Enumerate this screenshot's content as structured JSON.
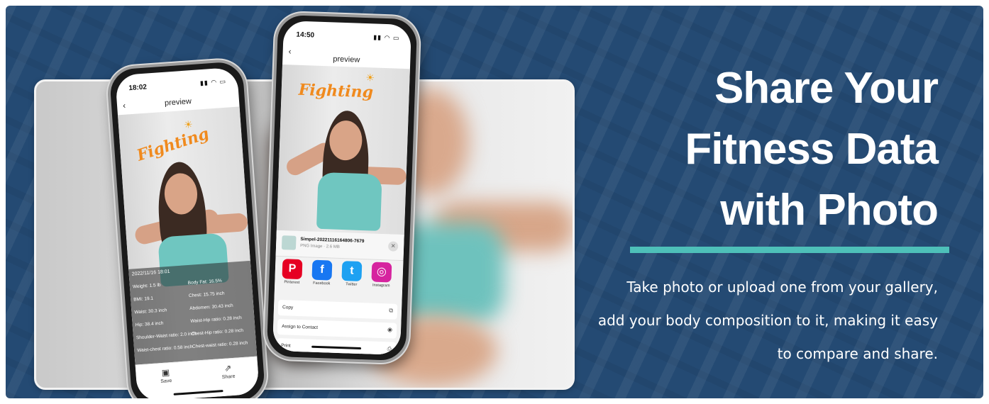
{
  "headline": {
    "line1": "Share Your",
    "line2": "Fitness Data",
    "line3": "with Photo"
  },
  "description": "Take photo or upload one from your gallery, add your body composition to it, making it easy to compare and share.",
  "colors": {
    "background": "#244a73",
    "accent": "#4ec0b9",
    "text": "#ffffff",
    "fighting": "#f08a1e"
  },
  "left_phone": {
    "time": "18:02",
    "title": "preview",
    "back_icon": "chevron-left-icon",
    "overlay_text": "Fighting",
    "date": "2022/11/16 18:01",
    "stats": [
      {
        "label": "Weight: 1.5 lb",
        "col": 0
      },
      {
        "label": "Body Fat: 16.5%",
        "col": 1
      },
      {
        "label": "BMI: 19.1",
        "col": 0
      },
      {
        "label": "Chest: 15.75 inch",
        "col": 1
      },
      {
        "label": "Waist: 30.3 inch",
        "col": 0
      },
      {
        "label": "Abdomen: 30.43 inch",
        "col": 1
      },
      {
        "label": "Hip: 38.4 inch",
        "col": 0
      },
      {
        "label": "Waist-Hip ratio: 0.28 inch",
        "col": 1
      },
      {
        "label": "Shoulder-Waist ratio: 2.0 inch",
        "col": 0
      },
      {
        "label": "Chest-Hip ratio: 0.28 inch",
        "col": 1
      },
      {
        "label": "Waist-chest ratio: 0.58 inch",
        "col": 0
      },
      {
        "label": "Chest-waist ratio: 0.28 inch",
        "col": 1
      }
    ],
    "save_label": "Save",
    "share_label": "Share"
  },
  "right_phone": {
    "time": "14:50",
    "title": "preview",
    "back_icon": "chevron-left-icon",
    "overlay_text": "Fighting",
    "file_name": "Simpel-20221116164806-7679",
    "file_meta": "PNG Image · 2.6 MB",
    "apps": [
      {
        "label": "Pinterest",
        "icon": "pinterest-icon",
        "color": "#e60023",
        "glyph": "P"
      },
      {
        "label": "Facebook",
        "icon": "facebook-icon",
        "color": "#1877f2",
        "glyph": "f"
      },
      {
        "label": "Twitter",
        "icon": "twitter-icon",
        "color": "#1da1f2",
        "glyph": "t"
      },
      {
        "label": "Instagram",
        "icon": "instagram-icon",
        "color": "#d6249f",
        "glyph": "◎"
      }
    ],
    "actions": [
      {
        "label": "Copy",
        "icon": "copy-icon"
      },
      {
        "label": "Assign to Contact",
        "icon": "contact-icon"
      },
      {
        "label": "Print",
        "icon": "print-icon"
      }
    ]
  }
}
